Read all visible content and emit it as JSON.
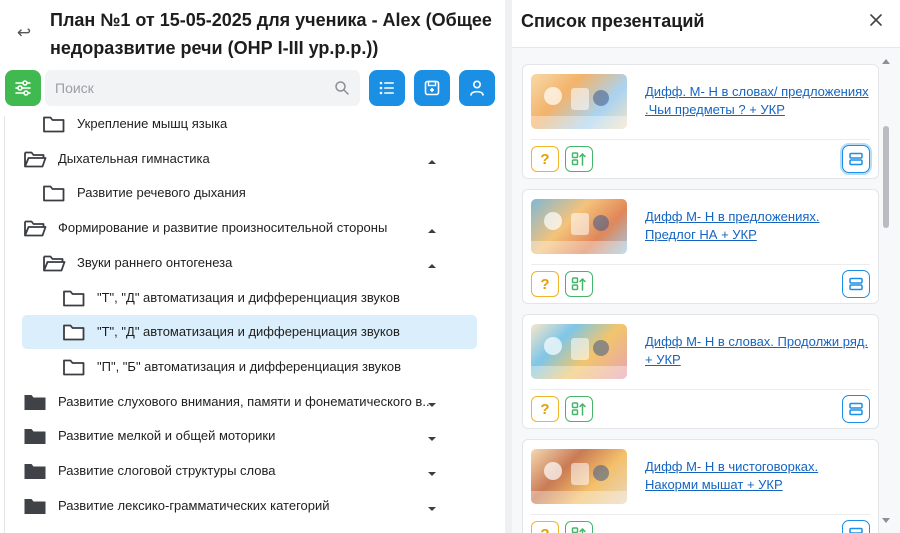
{
  "header": {
    "title": "План №1 от 15-05-2025 для ученика - Alex (Общее недоразвитие речи (ОНР I-III ур.р.р.))"
  },
  "search": {
    "placeholder": "Поиск"
  },
  "toolbar": {
    "filter_icon": "sliders-icon",
    "list_icon": "list-icon",
    "save_icon": "save-icon",
    "user_icon": "user-icon"
  },
  "tree": {
    "items": [
      {
        "label": "Укрепление мышц языка",
        "level": 1,
        "folder": "outline",
        "chevron": ""
      },
      {
        "label": "Дыхательная гимнастика",
        "level": 0,
        "folder": "open",
        "chevron": "up"
      },
      {
        "label": "Развитие речевого дыхания",
        "level": 1,
        "folder": "outline",
        "chevron": ""
      },
      {
        "label": "Формирование и развитие произносительной стороны",
        "level": 0,
        "folder": "open",
        "chevron": "up"
      },
      {
        "label": "Звуки раннего онтогенеза",
        "level": 1,
        "folder": "open",
        "chevron": "up"
      },
      {
        "label": "\"Т\", \"Д\" автоматизация и дифференциация звуков",
        "level": 2,
        "folder": "outline",
        "chevron": ""
      },
      {
        "label": "\"Т\", \"Д\" автоматизация и дифференциация звуков",
        "level": 2,
        "folder": "outline",
        "chevron": "",
        "selected": true
      },
      {
        "label": "\"П\", \"Б\" автоматизация и дифференциация звуков",
        "level": 2,
        "folder": "outline",
        "chevron": ""
      },
      {
        "label": "Развитие слухового внимания, памяти и фонематического в...",
        "level": 0,
        "folder": "filled",
        "chevron": "down"
      },
      {
        "label": "Развитие мелкой и общей моторики",
        "level": 0,
        "folder": "filled",
        "chevron": "down"
      },
      {
        "label": "Развитие слоговой структуры слова",
        "level": 0,
        "folder": "filled",
        "chevron": "down"
      },
      {
        "label": "Развитие лексико-грамматических категорий",
        "level": 0,
        "folder": "filled",
        "chevron": "down"
      }
    ]
  },
  "presentations": {
    "title": "Список презентаций",
    "question_label": "?",
    "items": [
      {
        "title": "Дифф. М- Н в словах/ предложениях .Чьи предметы ? + УКР",
        "active": true
      },
      {
        "title": "Дифф М- Н в предложениях. Предлог НА + УКР",
        "active": false
      },
      {
        "title": "Дифф М- Н в словах. Продолжи ряд. + УКР",
        "active": false
      },
      {
        "title": "Дифф М- Н в чистоговорках. Накорми мышат + УКР",
        "active": false
      }
    ]
  },
  "colors": {
    "green": "#3fb950",
    "blue": "#1a8fe3",
    "selected_row": "#dbeefc",
    "link": "#1565c0",
    "question": "#f0b429"
  }
}
